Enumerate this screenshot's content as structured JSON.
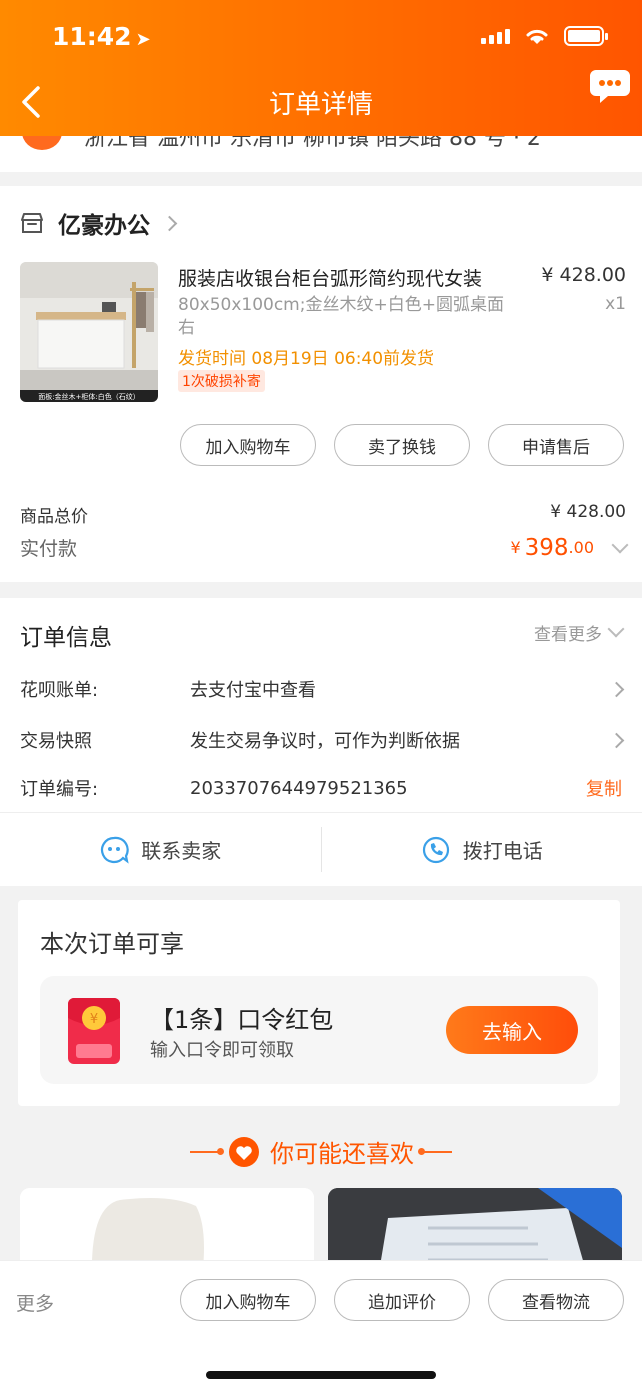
{
  "status_bar": {
    "time": "11:42"
  },
  "nav": {
    "title": "订单详情"
  },
  "address_strip": {
    "text": "浙江省 温州市 乐清市 柳市镇 陌头路 88 号 · 2"
  },
  "shop": {
    "name": "亿豪办公",
    "product": {
      "title": "服装店收银台柜台弧形简约现代女装",
      "spec": "80x50x100cm;金丝木纹+白色+圆弧桌面右",
      "ship_time": "发货时间  08月19日 06:40前发货",
      "tag": "1次破损补寄",
      "price": "¥ 428.00",
      "qty": "x1",
      "image_caption": "面板:金丝木+柜体:白色（石纹）"
    },
    "actions": [
      "加入购物车",
      "卖了换钱",
      "申请售后"
    ],
    "total_label": "商品总价",
    "total_value": "¥ 428.00",
    "paid_label": "实付款",
    "paid_currency": "¥",
    "paid_int": "398",
    "paid_dec": ".00"
  },
  "order_info": {
    "title": "订单信息",
    "more": "查看更多",
    "rows": [
      {
        "label": "花呗账单:",
        "value": "去支付宝中查看"
      },
      {
        "label": "交易快照",
        "value": "发生交易争议时，可作为判断依据"
      },
      {
        "label": "订单编号:",
        "value": "2033707644979521365",
        "action": "复制"
      }
    ],
    "contact_seller": "联系卖家",
    "call_phone": "拨打电话"
  },
  "perks": {
    "title": "本次订单可享",
    "item_name": "【1条】口令红包",
    "item_desc": "输入口令即可领取",
    "button": "去输入"
  },
  "recommend": {
    "title": "你可能还喜欢"
  },
  "bottom_bar": {
    "more": "更多",
    "buttons": [
      "加入购物车",
      "追加评价",
      "查看物流"
    ]
  },
  "colors": {
    "brand_orange": "#ff6a00",
    "price_orange": "#ff5000",
    "ship_time": "#f29000"
  }
}
